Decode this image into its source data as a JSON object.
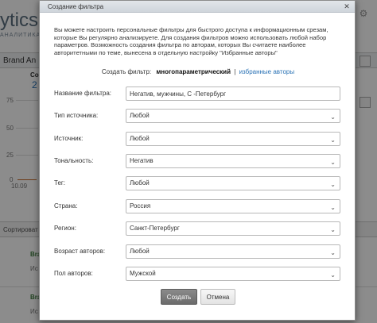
{
  "background": {
    "logo_text": "ytics",
    "logo_sub": "АНАЛИТИКА",
    "brand_bar_title": "Brand An",
    "chart_y_labels": [
      "75",
      "50",
      "25",
      "0"
    ],
    "chart_x_label": "10.09",
    "chart_top_label": "Co",
    "chart_number": "2",
    "sort_label": "Сортироват",
    "row_brand_1": "Bran",
    "row_brand_2": "Bra",
    "row_tail_1": "Ис",
    "row_tail_2": "Ис"
  },
  "dialog": {
    "title": "Создание фильтра",
    "close_label": "✕",
    "intro": "Вы можете настроить персональные фильтры для быстрого доступа к информационным срезам, которые Вы регулярно анализируете. Для создания фильтров можно использовать любой набор параметров. Возможность создания фильтра по авторам, которых Вы считаете наиболее авторитетными по теме, вынесена в отдельную настройку \"Избранные авторы\"",
    "mode": {
      "label": "Создать фильтр:",
      "active": "многопараметрический",
      "separator": "|",
      "link": "избранные авторы"
    },
    "fields": {
      "name": {
        "label": "Название фильтра:",
        "value": "Негатив, мужчины, С -Петербург"
      },
      "source_type": {
        "label": "Тип источника:",
        "value": "Любой"
      },
      "source": {
        "label": "Источник:",
        "value": "Любой"
      },
      "tonality": {
        "label": "Тональность:",
        "value": "Негатив"
      },
      "tag": {
        "label": "Тег:",
        "value": "Любой"
      },
      "country": {
        "label": "Страна:",
        "value": "Россия"
      },
      "region": {
        "label": "Регион:",
        "value": "Санкт-Петербург"
      },
      "age": {
        "label": "Возраст авторов:",
        "value": "Любой"
      },
      "gender": {
        "label": "Пол авторов:",
        "value": "Мужской"
      }
    },
    "buttons": {
      "create": "Создать",
      "cancel": "Отмена"
    }
  },
  "colors": {
    "link": "#2a72b5",
    "primary_button": "#7a7a7a",
    "overlay": "rgba(0,0,0,0.45)"
  }
}
